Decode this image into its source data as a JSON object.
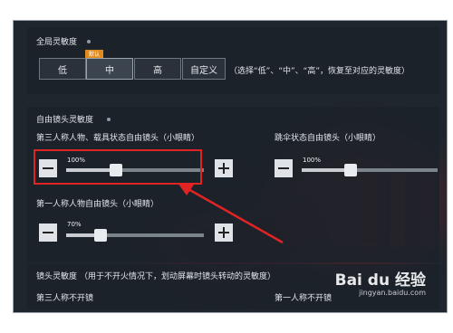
{
  "global_sensitivity": {
    "title": "全局灵敏度",
    "badge": "默认",
    "options": [
      "低",
      "中",
      "高",
      "自定义"
    ],
    "selected": "中",
    "hint": "（选择“低”、“中”、“高”，恢复至对应的灵敏度）"
  },
  "free_camera": {
    "title": "自由镜头灵敏度",
    "third_person_label": "第三人称人物、载具状态自由镜头（小眼睛）",
    "third_person_value": "100%",
    "third_person_level": 0.36,
    "parachute_label": "跳伞状态自由镜头（小眼睛）",
    "parachute_value": "100%",
    "parachute_level": 0.36,
    "first_person_label": "第一人称人物自由镜头（小眼睛）",
    "first_person_value": "70%",
    "first_person_level": 0.25
  },
  "camera_sensitivity": {
    "title": "镜头灵敏度",
    "hint": "（用于不开火情况下，划动屏幕时镜头转动的灵敏度）",
    "third_person_no_scope": "第三人称不开镜",
    "first_person_no_scope": "第一人称不开镜"
  },
  "watermark": {
    "brand": "Bai du 经验",
    "url": "jingyan.baidu.com"
  },
  "colors": {
    "annotation": "#e02424",
    "badge": "#e08b1d"
  }
}
